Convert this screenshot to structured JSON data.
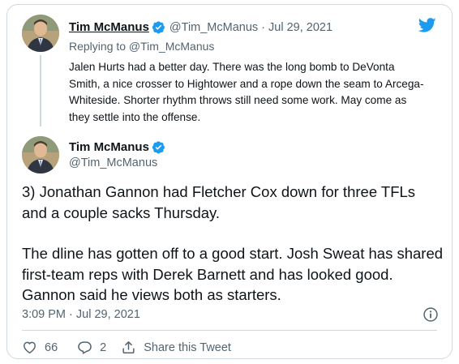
{
  "colors": {
    "twitter_blue": "#1d9bf0",
    "secondary_text": "#536471",
    "border": "#cfd9de"
  },
  "parent_tweet": {
    "author_name": "Tim McManus",
    "author_handle": "@Tim_McManus",
    "date": "· Jul 29, 2021",
    "replying_to": "Replying to @Tim_McManus",
    "text": "Jalen Hurts had a better day. There was the long bomb to DeVonta Smith, a nice crosser to Hightower and a rope down the seam to Arcega-Whiteside. Shorter rhythm throws still need some work. May come as they settle into the offense."
  },
  "main_tweet": {
    "author_name": "Tim McManus",
    "author_handle": "@Tim_McManus",
    "paragraph_1": "3) Jonathan Gannon had Fletcher Cox down for three TFLs and a couple sacks Thursday.",
    "paragraph_2": "The dline has gotten off to a good start. Josh Sweat has shared first-team reps with Derek Barnett and has looked good. Gannon said he views both as starters.",
    "timestamp": "3:09 PM · Jul 29, 2021"
  },
  "actions": {
    "like_count": "66",
    "reply_count": "2",
    "share_label": "Share this Tweet"
  },
  "icons": [
    "twitter-logo-icon",
    "verified-badge-icon",
    "info-icon",
    "heart-icon",
    "reply-bubble-icon",
    "share-icon"
  ]
}
